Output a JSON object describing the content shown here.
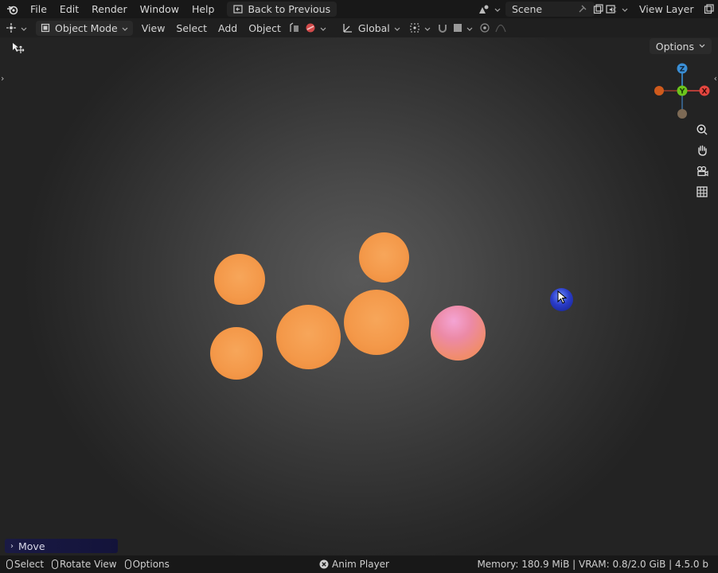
{
  "menubar": {
    "items": [
      "File",
      "Edit",
      "Render",
      "Window",
      "Help"
    ],
    "back_to_previous": "Back to Previous",
    "scene": "Scene",
    "view_layer": "View Layer"
  },
  "viewport_header": {
    "mode": "Object Mode",
    "menus": [
      "View",
      "Select",
      "Add",
      "Object"
    ],
    "transform_orientation": "Global"
  },
  "viewport": {
    "options_label": "Options",
    "gizmo_axes": {
      "z": "Z",
      "y": "Y",
      "x": "X"
    }
  },
  "operator_panel": {
    "label": "Move"
  },
  "statusbar": {
    "select": "Select",
    "rotate_view": "Rotate View",
    "options": "Options",
    "anim_player": "Anim Player",
    "stats": "Memory: 180.9 MiB | VRAM: 0.8/2.0 GiB | 4.5.0 b"
  },
  "colors": {
    "sphere_orange": "#f39a45",
    "sphere_pink": "#f08a8c",
    "sphere_blue": "#1a2fb0",
    "axis_x": "#e3463f",
    "axis_y": "#6cc51c",
    "axis_z": "#3a8fd6"
  }
}
